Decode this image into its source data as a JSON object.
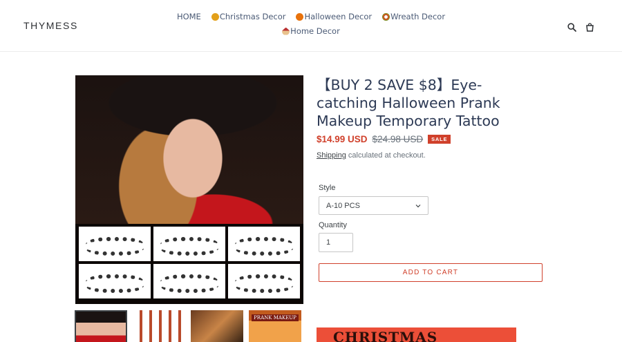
{
  "header": {
    "logo": "THYMESS",
    "nav": [
      {
        "label": "HOME",
        "icon": ""
      },
      {
        "label": "Christmas Decor",
        "icon": "cup-emoji"
      },
      {
        "label": "Halloween Decor",
        "icon": "pumpkin-emoji"
      },
      {
        "label": "Wreath Decor",
        "icon": "wreath-emoji"
      },
      {
        "label": "Home Decor",
        "icon": "house-emoji"
      }
    ]
  },
  "product": {
    "title": "【BUY 2 SAVE $8】Eye-catching Halloween Prank Makeup Temporary Tattoo",
    "price_sale": "$14.99 USD",
    "price_regular": "$24.98 USD",
    "sale_badge": "SALE",
    "shipping_link": "Shipping",
    "shipping_text": " calculated at checkout.",
    "style_label": "Style",
    "style_value": "A-10 PCS",
    "quantity_label": "Quantity",
    "quantity_value": "1",
    "add_to_cart": "ADD TO CART"
  },
  "thumbnails": {
    "prank_banner": "PRANK MAKEUP"
  },
  "promo": {
    "text": "CHRISTMAS"
  },
  "colors": {
    "accent": "#d0402b",
    "nav_text": "#4a5a75",
    "title_text": "#2d3a55"
  }
}
